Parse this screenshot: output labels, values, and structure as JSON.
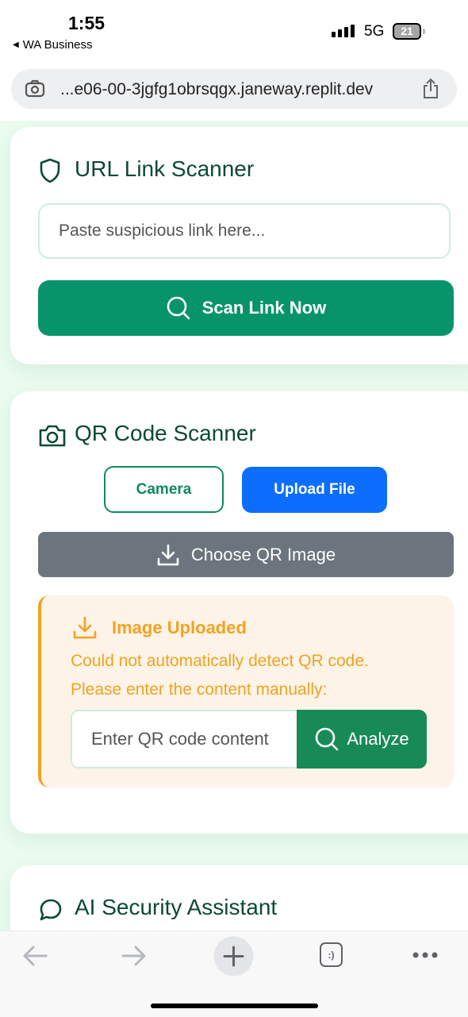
{
  "status_bar": {
    "time": "1:55",
    "back_app": "WA Business",
    "network": "5G",
    "battery": "21"
  },
  "browser": {
    "url": "...e06-00-3jgfg1obrsqgx.janeway.replit.dev"
  },
  "url_scanner": {
    "title": "URL Link Scanner",
    "icon": "shield-icon",
    "input_placeholder": "Paste suspicious link here...",
    "scan_button": "Scan Link Now"
  },
  "qr_scanner": {
    "title": "QR Code Scanner",
    "icon": "camera-icon",
    "tab_camera": "Camera",
    "tab_upload": "Upload File",
    "choose_button": "Choose QR Image",
    "alert": {
      "title": "Image Uploaded",
      "message_line1": "Could not automatically detect QR code.",
      "message_line2": "Please enter the content manually:",
      "input_placeholder": "Enter QR code content",
      "analyze_button": "Analyze"
    }
  },
  "ai_assistant": {
    "title": "AI Security Assistant",
    "icon": "chat-bubble-icon"
  },
  "bottom_nav": {
    "tabs_glyph": ":)"
  },
  "colors": {
    "primary_green": "#07946b",
    "dark_green_text": "#0b4a34",
    "upload_blue": "#0d6efd",
    "choose_gray": "#6c757d",
    "warning_orange": "#f0a321",
    "warning_bg": "#fdf3e6",
    "analyze_green": "#178a57",
    "page_bg": "#eafbf0"
  }
}
